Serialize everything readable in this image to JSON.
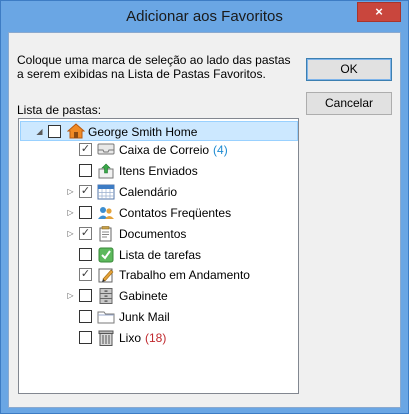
{
  "dialog": {
    "title": "Adicionar aos Favoritos",
    "close_glyph": "×",
    "instructions": "Coloque uma marca de seleção ao lado das pastas a serem exibidas na Lista de Pastas Favoritos.",
    "list_label": "Lista de pastas:",
    "ok_label": "OK",
    "cancel_label": "Cancelar"
  },
  "tree": {
    "root": {
      "label": "George Smith Home",
      "expander": "◢",
      "checked": false,
      "icon": "home-icon"
    },
    "items": [
      {
        "label": "Caixa de Correio",
        "count": "(4)",
        "count_color": "#1e8bd1",
        "checked": true,
        "expander": "",
        "icon": "inbox-icon"
      },
      {
        "label": "Itens Enviados",
        "count": "",
        "checked": false,
        "expander": "",
        "icon": "sent-items-icon"
      },
      {
        "label": "Calendário",
        "count": "",
        "checked": true,
        "expander": "▷",
        "icon": "calendar-icon"
      },
      {
        "label": "Contatos Freqüentes",
        "count": "",
        "checked": false,
        "expander": "▷",
        "icon": "contacts-icon"
      },
      {
        "label": "Documentos",
        "count": "",
        "checked": true,
        "expander": "▷",
        "icon": "documents-icon"
      },
      {
        "label": "Lista de tarefas",
        "count": "",
        "checked": false,
        "expander": "",
        "icon": "tasks-icon"
      },
      {
        "label": "Trabalho em Andamento",
        "count": "",
        "checked": true,
        "expander": "",
        "icon": "work-in-progress-icon"
      },
      {
        "label": "Gabinete",
        "count": "",
        "checked": false,
        "expander": "▷",
        "icon": "cabinet-icon"
      },
      {
        "label": "Junk Mail",
        "count": "",
        "checked": false,
        "expander": "",
        "icon": "folder-icon"
      },
      {
        "label": "Lixo",
        "count": "(18)",
        "count_color": "#c0282d",
        "checked": false,
        "expander": "",
        "icon": "trash-icon"
      }
    ]
  },
  "check_glyph": "✓"
}
